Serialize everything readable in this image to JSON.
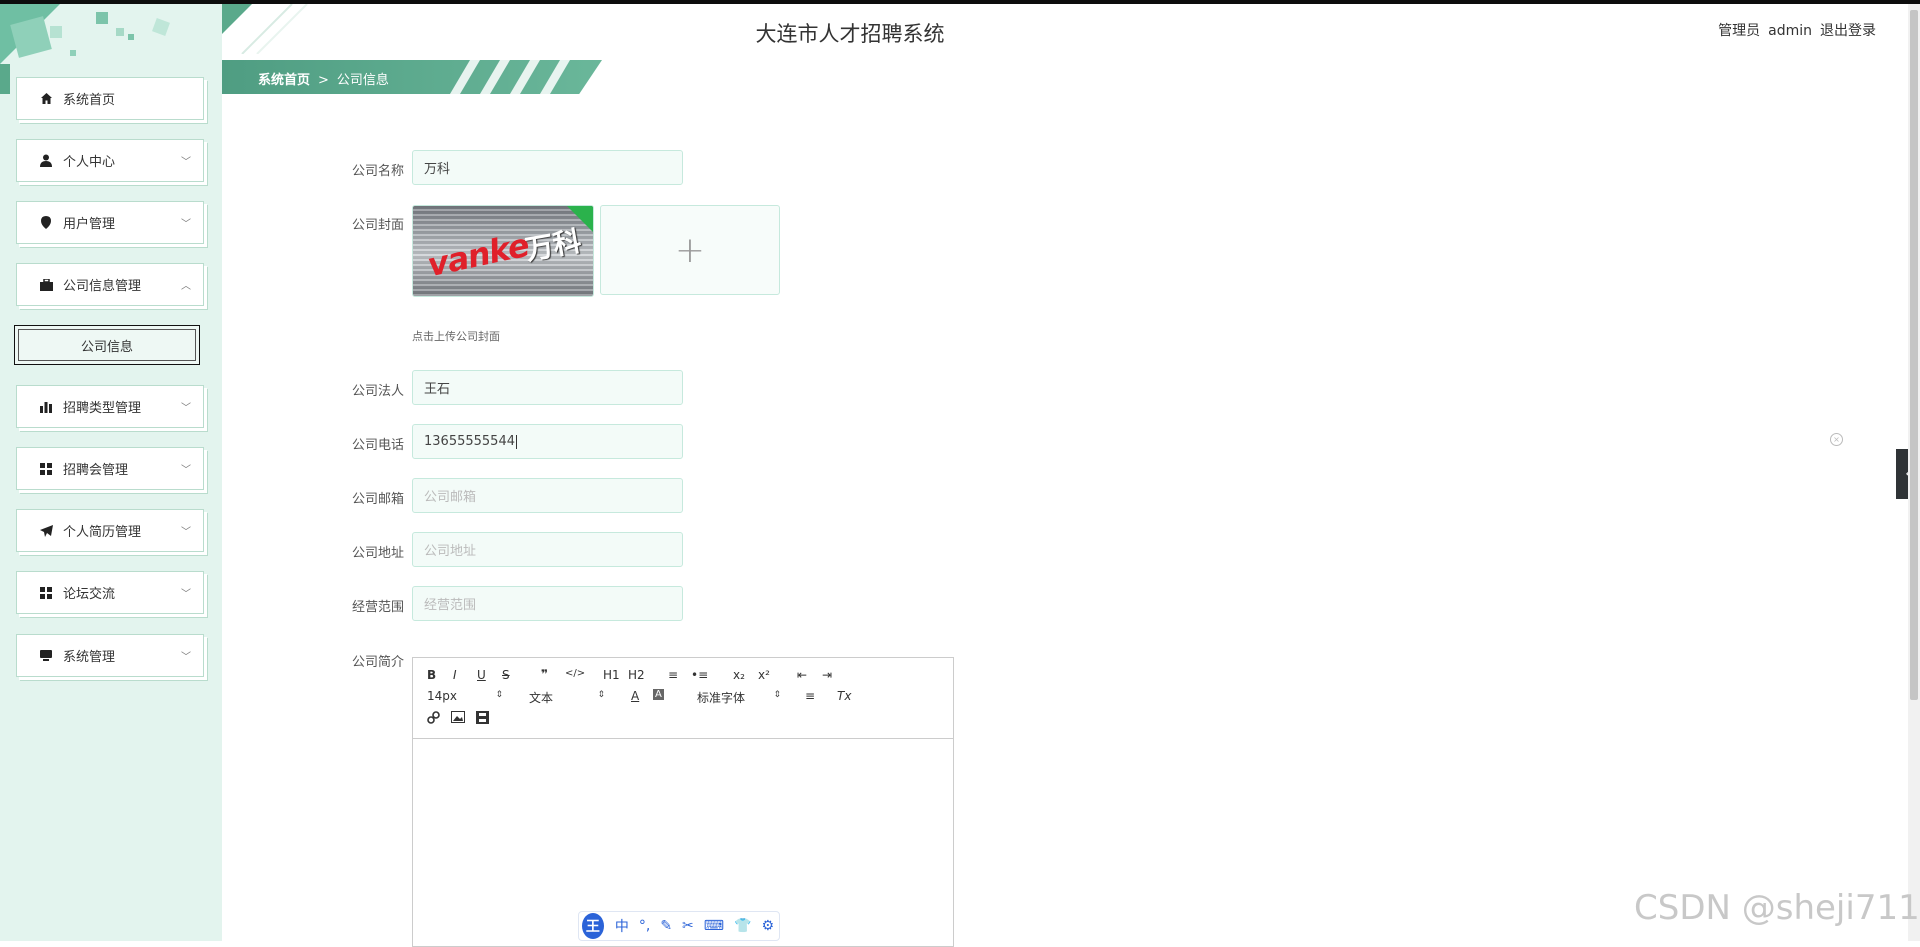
{
  "app": {
    "title": "大连市人才招聘系统"
  },
  "header": {
    "role": "管理员",
    "username": "admin",
    "logout": "退出登录"
  },
  "breadcrumb": {
    "home": "系统首页",
    "separator": ">",
    "current": "公司信息"
  },
  "sidebar": {
    "items": [
      {
        "label": "系统首页",
        "icon": "home-icon"
      },
      {
        "label": "个人中心",
        "icon": "user-icon"
      },
      {
        "label": "用户管理",
        "icon": "pin-icon"
      },
      {
        "label": "公司信息管理",
        "icon": "briefcase-icon",
        "expanded": true
      },
      {
        "label": "招聘类型管理",
        "icon": "bar-chart-icon"
      },
      {
        "label": "招聘会管理",
        "icon": "grid-icon"
      },
      {
        "label": "个人简历管理",
        "icon": "paper-plane-icon"
      },
      {
        "label": "论坛交流",
        "icon": "grid-icon"
      },
      {
        "label": "系统管理",
        "icon": "monitor-icon"
      }
    ],
    "submenu": {
      "label": "公司信息"
    }
  },
  "form": {
    "company_name": {
      "label": "公司名称",
      "value": "万科"
    },
    "cover": {
      "label": "公司封面",
      "hint": "点击上传公司封面",
      "image_text": "vanke",
      "image_text_cn": "万科",
      "upload_symbol": "+"
    },
    "legal_person": {
      "label": "公司法人",
      "value": "王石"
    },
    "phone": {
      "label": "公司电话",
      "value": "13655555544"
    },
    "email": {
      "label": "公司邮箱",
      "placeholder": "公司邮箱"
    },
    "address": {
      "label": "公司地址",
      "placeholder": "公司地址"
    },
    "scope": {
      "label": "经营范围",
      "placeholder": "经营范围"
    },
    "intro": {
      "label": "公司简介"
    }
  },
  "editor": {
    "row1": [
      "B",
      "I",
      "U",
      "S",
      "❞",
      "</>",
      "H1",
      "H2",
      "≡",
      "•≡",
      "x₂",
      "x²",
      "⇤",
      "⇥"
    ],
    "font_size": "14px",
    "format": "文本",
    "font_color": "A",
    "bg_color": "A",
    "font_family": "标准字体",
    "align": "≡",
    "clear": "Tx"
  },
  "ime": {
    "logo": "王",
    "lang": "中",
    "punct": "°,",
    "icons": [
      "pen-icon",
      "scissors-icon",
      "keyboard-icon",
      "shirt-icon",
      "gear-icon"
    ]
  },
  "watermark": "CSDN @sheji711",
  "colors": {
    "accent": "#5aa98b",
    "sidebar_bg": "#e3f4ee",
    "input_border": "#c6e9dd"
  }
}
